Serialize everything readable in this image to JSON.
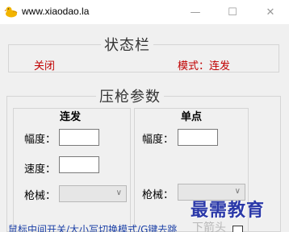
{
  "window": {
    "title": "www.xiaodao.la",
    "min_glyph": "—",
    "max_glyph": "☐",
    "close_glyph": "✕",
    "icon": "duck-icon"
  },
  "status": {
    "legend": "状态栏",
    "state": "关闭",
    "mode": "模式：连发"
  },
  "params": {
    "legend": "压枪参数",
    "burst": {
      "title": "连发",
      "amplitude_label": "幅度：",
      "amplitude_value": "",
      "speed_label": "速度：",
      "speed_value": "",
      "gun_label": "枪械：",
      "gun_value": ""
    },
    "single": {
      "title": "单点",
      "amplitude_label": "幅度：",
      "amplitude_value": "",
      "gun_label": "枪械：",
      "gun_value": ""
    }
  },
  "footer": {
    "hint": "鼠标中间开关/大小写切换模式/G键去跳",
    "watermark_ghost": "下箭头"
  },
  "watermark": "最需教育",
  "colors": {
    "status_red": "#c00000",
    "link_blue": "#1a3fa6",
    "watermark_blue": "#2a38a8"
  }
}
